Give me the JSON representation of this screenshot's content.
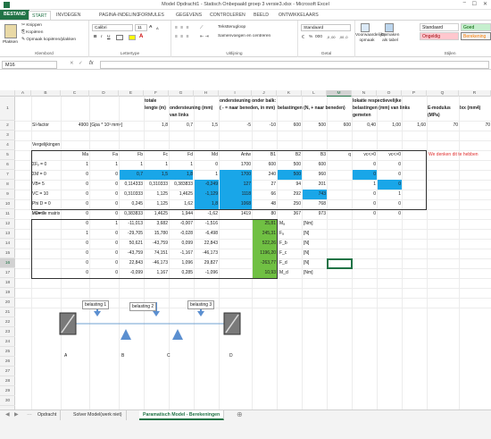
{
  "window": {
    "title": "Model Opdracht1 - Statisch Onbepaald groep 3 versie3.xlsx - Microsoft Excel"
  },
  "ribbon": {
    "tabs": [
      "BESTAND",
      "START",
      "INVOEGEN",
      "PAGINA-INDELING",
      "FORMULES",
      "GEGEVENS",
      "CONTROLEREN",
      "BEELD",
      "ONTWIKKELAARS"
    ],
    "clipboard": {
      "paste": "Plakken",
      "cut": "Knippen",
      "copy": "Kopiëren",
      "format_painter": "Opmaak kopiëren/plakken",
      "label": "Klembord"
    },
    "font": {
      "name": "Calibri",
      "size": "11",
      "label": "Lettertype",
      "bold": "B",
      "italic": "I",
      "underline": "U",
      "grow": "A",
      "shrink": "A"
    },
    "alignment": {
      "wrap": "Tekstterugloop",
      "merge": "Samenvoegen en centreren",
      "label": "Uitlijning"
    },
    "number": {
      "format": "Standaard",
      "label": "Getal",
      "percent": "%",
      "thousands": "000",
      "inc_dec": ",0 ,00",
      "dec_dec": ",00 ,0"
    },
    "styles": {
      "cond_format": "Voorwaardelijke opmaak",
      "format_table": "Opmaken als tabel",
      "normal": "Standaard",
      "good": "Goed",
      "bad": "Ongeldig",
      "calc": "Berekening",
      "label": "Stijlen"
    }
  },
  "formula_bar": {
    "name_box": "M16",
    "fx": "fx",
    "cancel": "✕",
    "enter": "✓",
    "value": ""
  },
  "columns": [
    "A",
    "B",
    "C",
    "D",
    "E",
    "F",
    "G",
    "H",
    "I",
    "J",
    "K",
    "L",
    "M",
    "N",
    "O",
    "P",
    "Q",
    "R"
  ],
  "rows": [
    "1",
    "2",
    "3",
    "4",
    "5",
    "6",
    "7",
    "8",
    "9",
    "10",
    "11",
    "12",
    "13",
    "14",
    "15",
    "16",
    "17",
    "18",
    "19",
    "20",
    "21",
    "22",
    "23",
    "24",
    "25",
    "26",
    "27",
    "28",
    "29",
    "30",
    "31",
    "32",
    "33",
    "34"
  ],
  "sheet": {
    "hdr_totale": "totale lengte (m)",
    "hdr_ondersteuning": "ondersteuning (mm) van links",
    "hdr_onder_balk": "ondersteuning onder balk: ( - = naar beneden, in mm)",
    "hdr_belastingen": "belastingen (N, + naar beneden)",
    "hdr_lokatie": "lokatie respectievelijke belastingen (mm) van links gemeten",
    "hdr_emod": "E-modulus (MPa)",
    "hdr_ixx": "Ixx (mm4)",
    "si_label": "SI-factor",
    "si_value": "4900",
    "si_unit": "[Gpa * 10³ mm⁴]",
    "row2": [
      "1,8",
      "0,7",
      "1,5",
      "-5",
      "-10",
      "600",
      "500",
      "600",
      "0,40",
      "1,00",
      "1,60",
      "70",
      "70"
    ],
    "vergelijkingen": "Vergelijkingen",
    "eq_headers": [
      "Ma",
      "Fa",
      "Fb",
      "Fc",
      "Fd",
      "Md",
      "Antw",
      "B1",
      "B2",
      "B3",
      "q",
      "vc<>0",
      "vc<>0"
    ],
    "eq_rows": [
      {
        "label": "ΣFᵧ = 0",
        "vals": [
          "1",
          "1",
          "1",
          "1",
          "1",
          "0",
          "1700",
          "600",
          "500",
          "600",
          "",
          "0",
          "0"
        ]
      },
      {
        "label": "ΣM = 0",
        "vals": [
          "0",
          "0",
          "0,7",
          "1,5",
          "1,8",
          "1",
          "1700",
          "240",
          "500",
          "960",
          "",
          "0",
          "0"
        ]
      },
      {
        "label": "VB= 5",
        "vals": [
          "0",
          "0",
          "0,114333",
          "0,310333",
          "0,383833",
          "-0,249",
          "127",
          "27",
          "94",
          "201",
          "",
          "1",
          "0"
        ]
      },
      {
        "label": "VC = 10",
        "vals": [
          "0",
          "0",
          "0,310333",
          "1,125",
          "1,4625",
          "-1,129",
          "1118",
          "66",
          "292",
          "743",
          "",
          "0",
          "1"
        ]
      },
      {
        "label": "Phi D = 0",
        "vals": [
          "0",
          "0",
          "0,245",
          "1,125",
          "1,62",
          "1,8",
          "1068",
          "48",
          "250",
          "768",
          "",
          "0",
          "0"
        ]
      },
      {
        "label": "VD= 0",
        "vals": [
          "0",
          "0",
          "0,383833",
          "1,4625",
          "1,944",
          "-1,62",
          "1419",
          "80",
          "367",
          "973",
          "",
          "0",
          "0"
        ]
      }
    ],
    "note": "We denken dit te hebben",
    "inverse_title": "Inverse matrix",
    "inv_rows": [
      {
        "vals": [
          "0",
          "1",
          "-11,013",
          "3,682",
          "-0,007",
          "-1,516"
        ],
        "res": "25,81",
        "sym": "Mₐ",
        "unit": "[Nm]"
      },
      {
        "vals": [
          "1",
          "0",
          "-29,705",
          "15,780",
          "-0,028",
          "-6,498"
        ],
        "res": "245,31",
        "sym": "Fₐ",
        "unit": "[N]"
      },
      {
        "vals": [
          "0",
          "0",
          "50,621",
          "-43,759",
          "0,099",
          "22,843"
        ],
        "res": "522,26",
        "sym": "F_b",
        "unit": "[N]"
      },
      {
        "vals": [
          "0",
          "0",
          "-43,759",
          "74,151",
          "-1,167",
          "-46,173"
        ],
        "res": "1196,20",
        "sym": "F_c",
        "unit": "[N]"
      },
      {
        "vals": [
          "0",
          "0",
          "22,843",
          "-46,173",
          "1,096",
          "29,827"
        ],
        "res": "-263,77",
        "sym": "F_d",
        "unit": "[N]"
      },
      {
        "vals": [
          "0",
          "0",
          "-0,099",
          "1,167",
          "0,285",
          "-1,096"
        ],
        "res": "10,93",
        "sym": "M_d",
        "unit": "[Nm]"
      }
    ],
    "diagram": {
      "load1": "belasting 1",
      "load2": "belasting 2",
      "load3": "belasting 3",
      "A": "A",
      "B": "B",
      "C": "C",
      "D": "D"
    }
  },
  "sheet_tabs": [
    "Opdracht",
    "Solver Model(werk niet)",
    "Paramatisch Model - Berekeningen"
  ],
  "colors": {
    "excel_green": "#217346",
    "cell_blue": "#19a6e8",
    "cell_green": "#70c043",
    "note_red": "#e03030"
  }
}
